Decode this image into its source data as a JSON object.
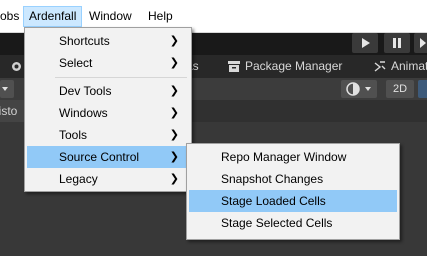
{
  "menubar": {
    "items": [
      {
        "label": "obs"
      },
      {
        "label": "Ardenfall"
      },
      {
        "label": "Window"
      },
      {
        "label": "Help"
      }
    ]
  },
  "editor": {
    "tabs": [
      {
        "label": "as"
      },
      {
        "label": "Package Manager"
      },
      {
        "label": "Animat"
      }
    ],
    "view_mode_label": "2D",
    "left_stub_label": "listo"
  },
  "ardenfall_menu": {
    "items": [
      {
        "label": "Shortcuts",
        "submenu": true
      },
      {
        "label": "Select",
        "submenu": true
      },
      {
        "label": "Dev Tools",
        "submenu": true
      },
      {
        "label": "Windows",
        "submenu": true
      },
      {
        "label": "Tools",
        "submenu": true
      },
      {
        "label": "Source Control",
        "submenu": true,
        "highlighted": true
      },
      {
        "label": "Legacy",
        "submenu": true
      }
    ]
  },
  "source_control_menu": {
    "items": [
      {
        "label": "Repo Manager Window"
      },
      {
        "label": "Snapshot Changes"
      },
      {
        "label": "Stage Loaded Cells",
        "highlighted": true
      },
      {
        "label": "Stage Selected Cells"
      }
    ]
  },
  "colors": {
    "menu_highlight": "#91c9f7",
    "menubar_active": "#cce8ff",
    "editor_dark": "#383838"
  }
}
